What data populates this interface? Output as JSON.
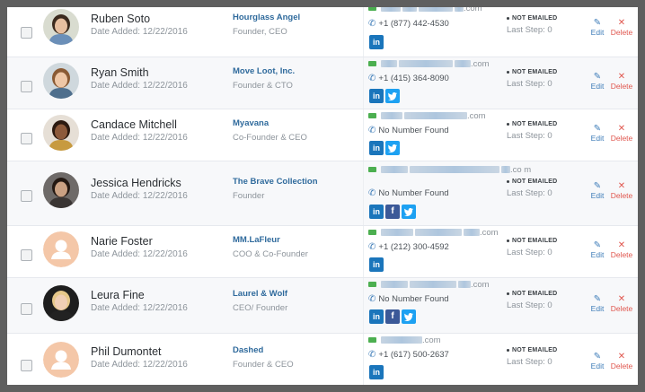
{
  "contacts": [
    {
      "name": "Ruben Soto",
      "date_added": "Date Added: 12/22/2016",
      "company": "Hourglass Angel",
      "title": "Founder, CEO",
      "email_visible": ".com",
      "phone": "+1 (877) 442-4530",
      "social": [
        "in"
      ],
      "status": "NOT EMAILED",
      "last_step": "Last Step: 0",
      "avatar": "photo"
    },
    {
      "name": "Ryan Smith",
      "date_added": "Date Added: 12/22/2016",
      "company": "Move Loot, Inc.",
      "title": "Founder & CTO",
      "email_visible": ".com",
      "phone": "+1 (415) 364-8090",
      "social": [
        "in",
        "t"
      ],
      "status": "NOT EMAILED",
      "last_step": "Last Step: 0",
      "avatar": "photo"
    },
    {
      "name": "Candace Mitchell",
      "date_added": "Date Added: 12/22/2016",
      "company": "Myavana",
      "title": "Co-Founder & CEO",
      "email_visible": ".com",
      "phone": "No Number Found",
      "social": [
        "in",
        "t"
      ],
      "status": "NOT EMAILED",
      "last_step": "Last Step: 0",
      "avatar": "photo"
    },
    {
      "name": "Jessica Hendricks",
      "date_added": "Date Added: 12/22/2016",
      "company": "The Brave Collection",
      "title": "Founder",
      "email_visible": ".co m",
      "phone": "No Number Found",
      "social": [
        "in",
        "f",
        "t"
      ],
      "status": "NOT EMAILED",
      "last_step": "Last Step: 0",
      "avatar": "photo"
    },
    {
      "name": "Narie Foster",
      "date_added": "Date Added: 12/22/2016",
      "company": "MM.LaFleur",
      "title": "COO & Co-Founder",
      "email_visible": ".com",
      "phone": "+1 (212) 300-4592",
      "social": [
        "in"
      ],
      "status": "NOT EMAILED",
      "last_step": "Last Step: 0",
      "avatar": "placeholder"
    },
    {
      "name": "Leura Fine",
      "date_added": "Date Added: 12/22/2016",
      "company": "Laurel & Wolf",
      "title": "CEO/ Founder",
      "email_visible": ".com",
      "phone": "No Number Found",
      "social": [
        "in",
        "f",
        "t"
      ],
      "status": "NOT EMAILED",
      "last_step": "Last Step: 0",
      "avatar": "photo"
    },
    {
      "name": "Phil Dumontet",
      "date_added": "Date Added: 12/22/2016",
      "company": "Dashed",
      "title": "Founder & CEO",
      "email_visible": ".com",
      "phone": "+1 (617) 500-2637",
      "social": [
        "in"
      ],
      "status": "NOT EMAILED",
      "last_step": "Last Step: 0",
      "avatar": "placeholder"
    }
  ],
  "actions": {
    "edit_label": "Edit",
    "delete_label": "Delete"
  },
  "icons": {
    "email": "envelope-icon",
    "phone": "phone-icon",
    "edit": "pencil-square-icon",
    "delete": "x-icon",
    "linkedin": "linkedin-icon",
    "facebook": "facebook-icon",
    "twitter": "twitter-icon"
  },
  "colors": {
    "company_link": "#2f6a9c",
    "email_icon": "#4caf50",
    "linkedin": "#1a75bb",
    "facebook": "#3b5998",
    "twitter": "#1da1f2",
    "delete": "#e0574f",
    "placeholder_avatar": "#f4c7a8"
  }
}
